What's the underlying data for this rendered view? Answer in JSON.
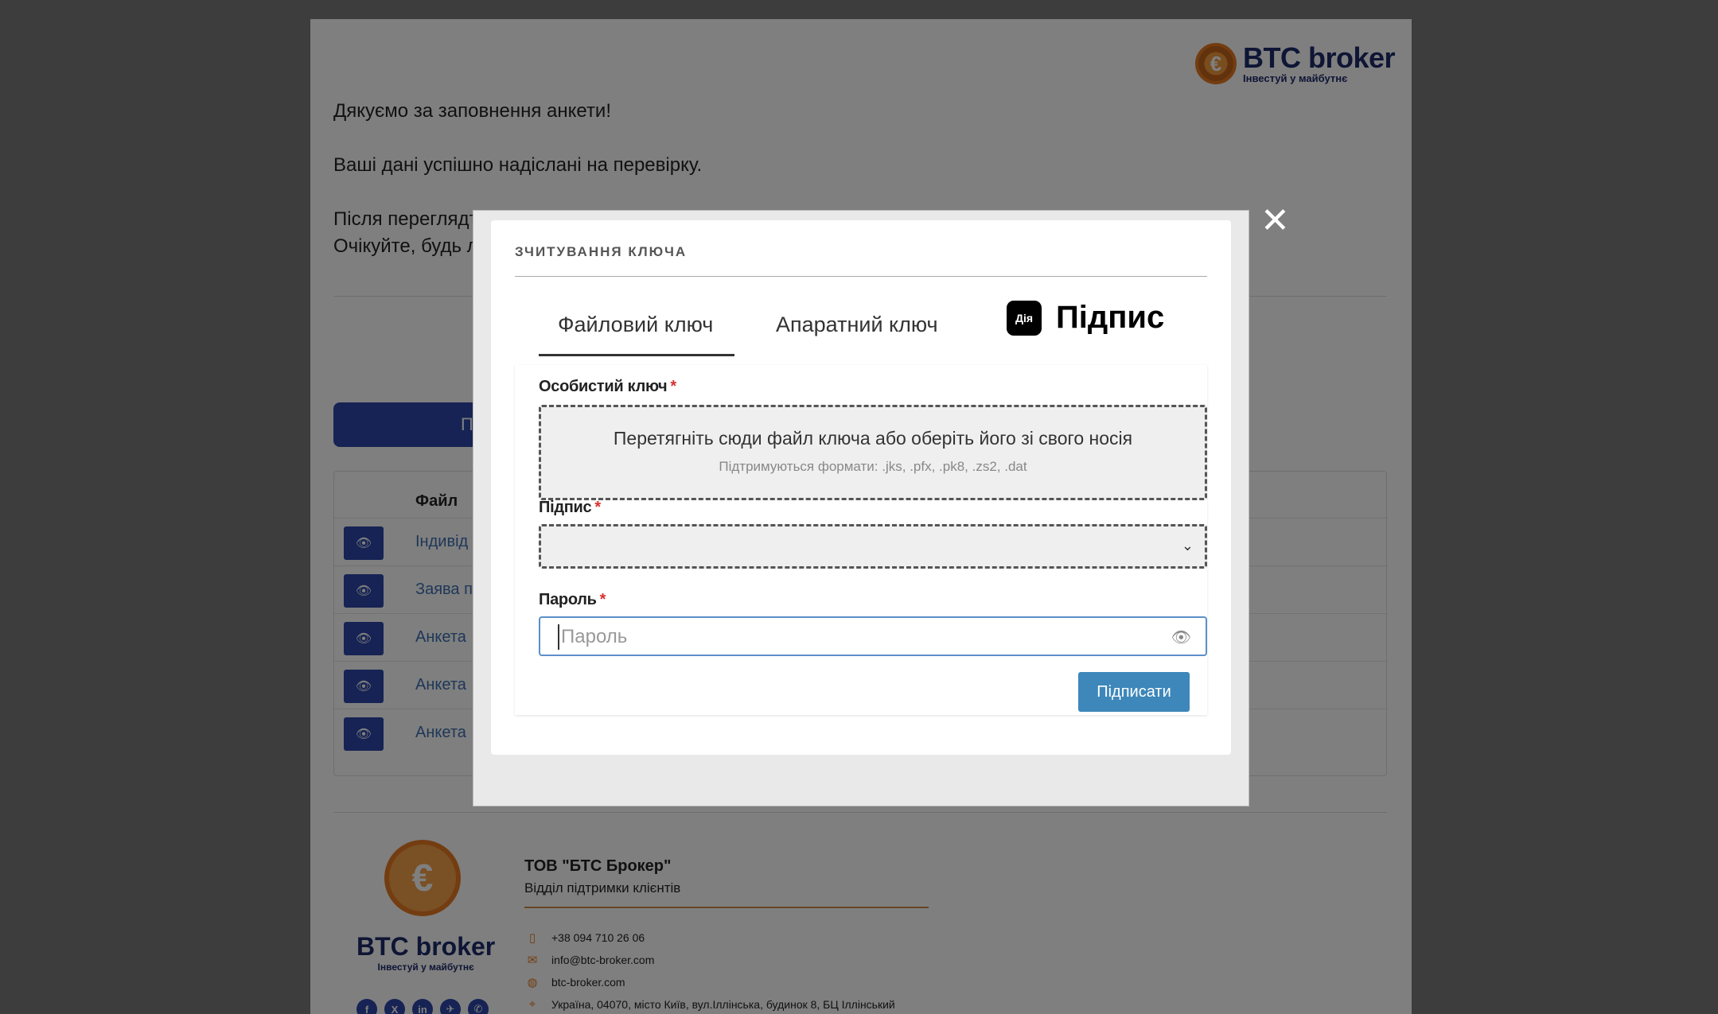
{
  "brand": {
    "name": "BTC broker",
    "slogan": "Інвестуй у майбутнє"
  },
  "background": {
    "thanks": "Дякуємо за заповнення анкети!",
    "sent": "Ваші дані успішно надіслані на перевірку.",
    "after_review": "Після переглядт.",
    "wait": "Очікуйте, будь л",
    "button_partial": "П",
    "table_header_file": "Файл",
    "rows": [
      "Індивід",
      "Заява п",
      "Анкета",
      "Анкета",
      "Анкета"
    ]
  },
  "footer": {
    "company": "ТОВ \"БТС Брокер\"",
    "department": "Відділ підтримки клієнтів",
    "phone": "+38 094 710 26 06",
    "email": "info@btc-broker.com",
    "website": "btc-broker.com",
    "address": "Україна, 04070, місто Київ, вул.Іллінська, будинок 8, БЦ Іллінський",
    "socials": [
      "f",
      "X",
      "in",
      "✈",
      "✆"
    ]
  },
  "modal": {
    "title": "ЗЧИТУВАННЯ КЛЮЧА",
    "close": "✕",
    "tabs": {
      "file_key": "Файловий ключ",
      "hardware_key": "Апаратний ключ",
      "diya_logo": "Дія",
      "diya_sign": "Підпис"
    },
    "personal_key_label": "Особистий ключ",
    "required_mark": "*",
    "dropzone_main": "Перетягніть сюди файл ключа або оберіть його зі свого носія",
    "dropzone_formats": "Підтримуються формати: .jks, .pfx, .pk8, .zs2, .dat",
    "signature_label": "Підпис",
    "password_label": "Пароль",
    "password_placeholder": "Пароль",
    "sign_button": "Підписати"
  }
}
